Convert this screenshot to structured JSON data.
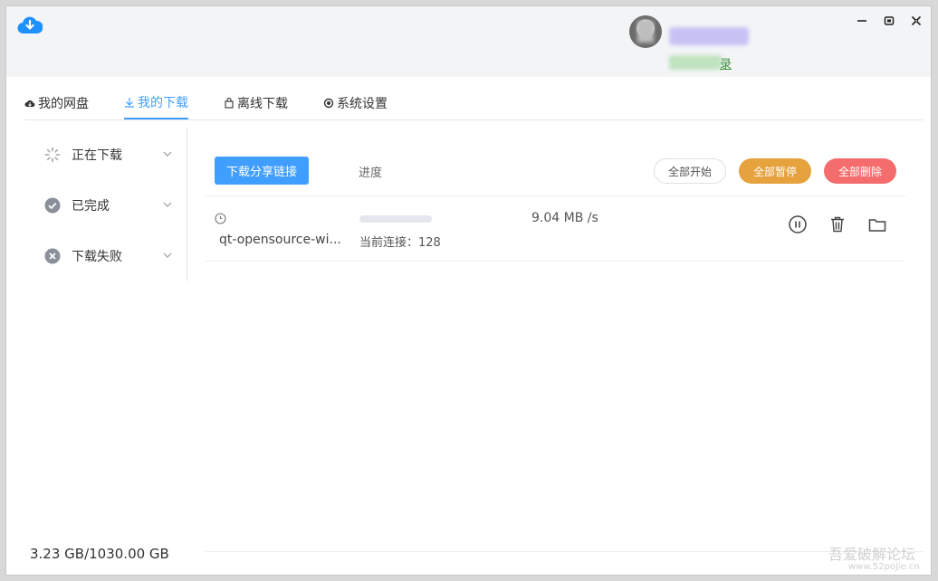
{
  "user": {
    "login_text_visible": "录"
  },
  "tabs": [
    {
      "label": "我的网盘",
      "icon": "cloud-icon"
    },
    {
      "label": "我的下载",
      "icon": "download-icon"
    },
    {
      "label": "离线下载",
      "icon": "bag-icon"
    },
    {
      "label": "系统设置",
      "icon": "settings-icon"
    }
  ],
  "sidebar": {
    "items": [
      {
        "label": "正在下载",
        "icon": "spinner-icon"
      },
      {
        "label": "已完成",
        "icon": "check-circle-icon"
      },
      {
        "label": "下载失败",
        "icon": "x-circle-icon"
      }
    ]
  },
  "toolbar": {
    "share_label": "下载分享链接",
    "progress_header": "进度",
    "start_all": "全部开始",
    "pause_all": "全部暂停",
    "delete_all": "全部删除"
  },
  "downloads": [
    {
      "filename": "qt-opensource-wi...",
      "progress": 0.0,
      "connections": "当前连接：128",
      "speed": "9.04 MB /s"
    }
  ],
  "footer": {
    "storage": "3.23 GB/1030.00 GB"
  },
  "watermark": {
    "text": "吾爱破解论坛",
    "url": "www.52pojie.cn"
  },
  "colors": {
    "primary": "#409eff",
    "warning": "#e6a23c",
    "danger": "#f56c6c",
    "success": "#3a8f3a"
  }
}
